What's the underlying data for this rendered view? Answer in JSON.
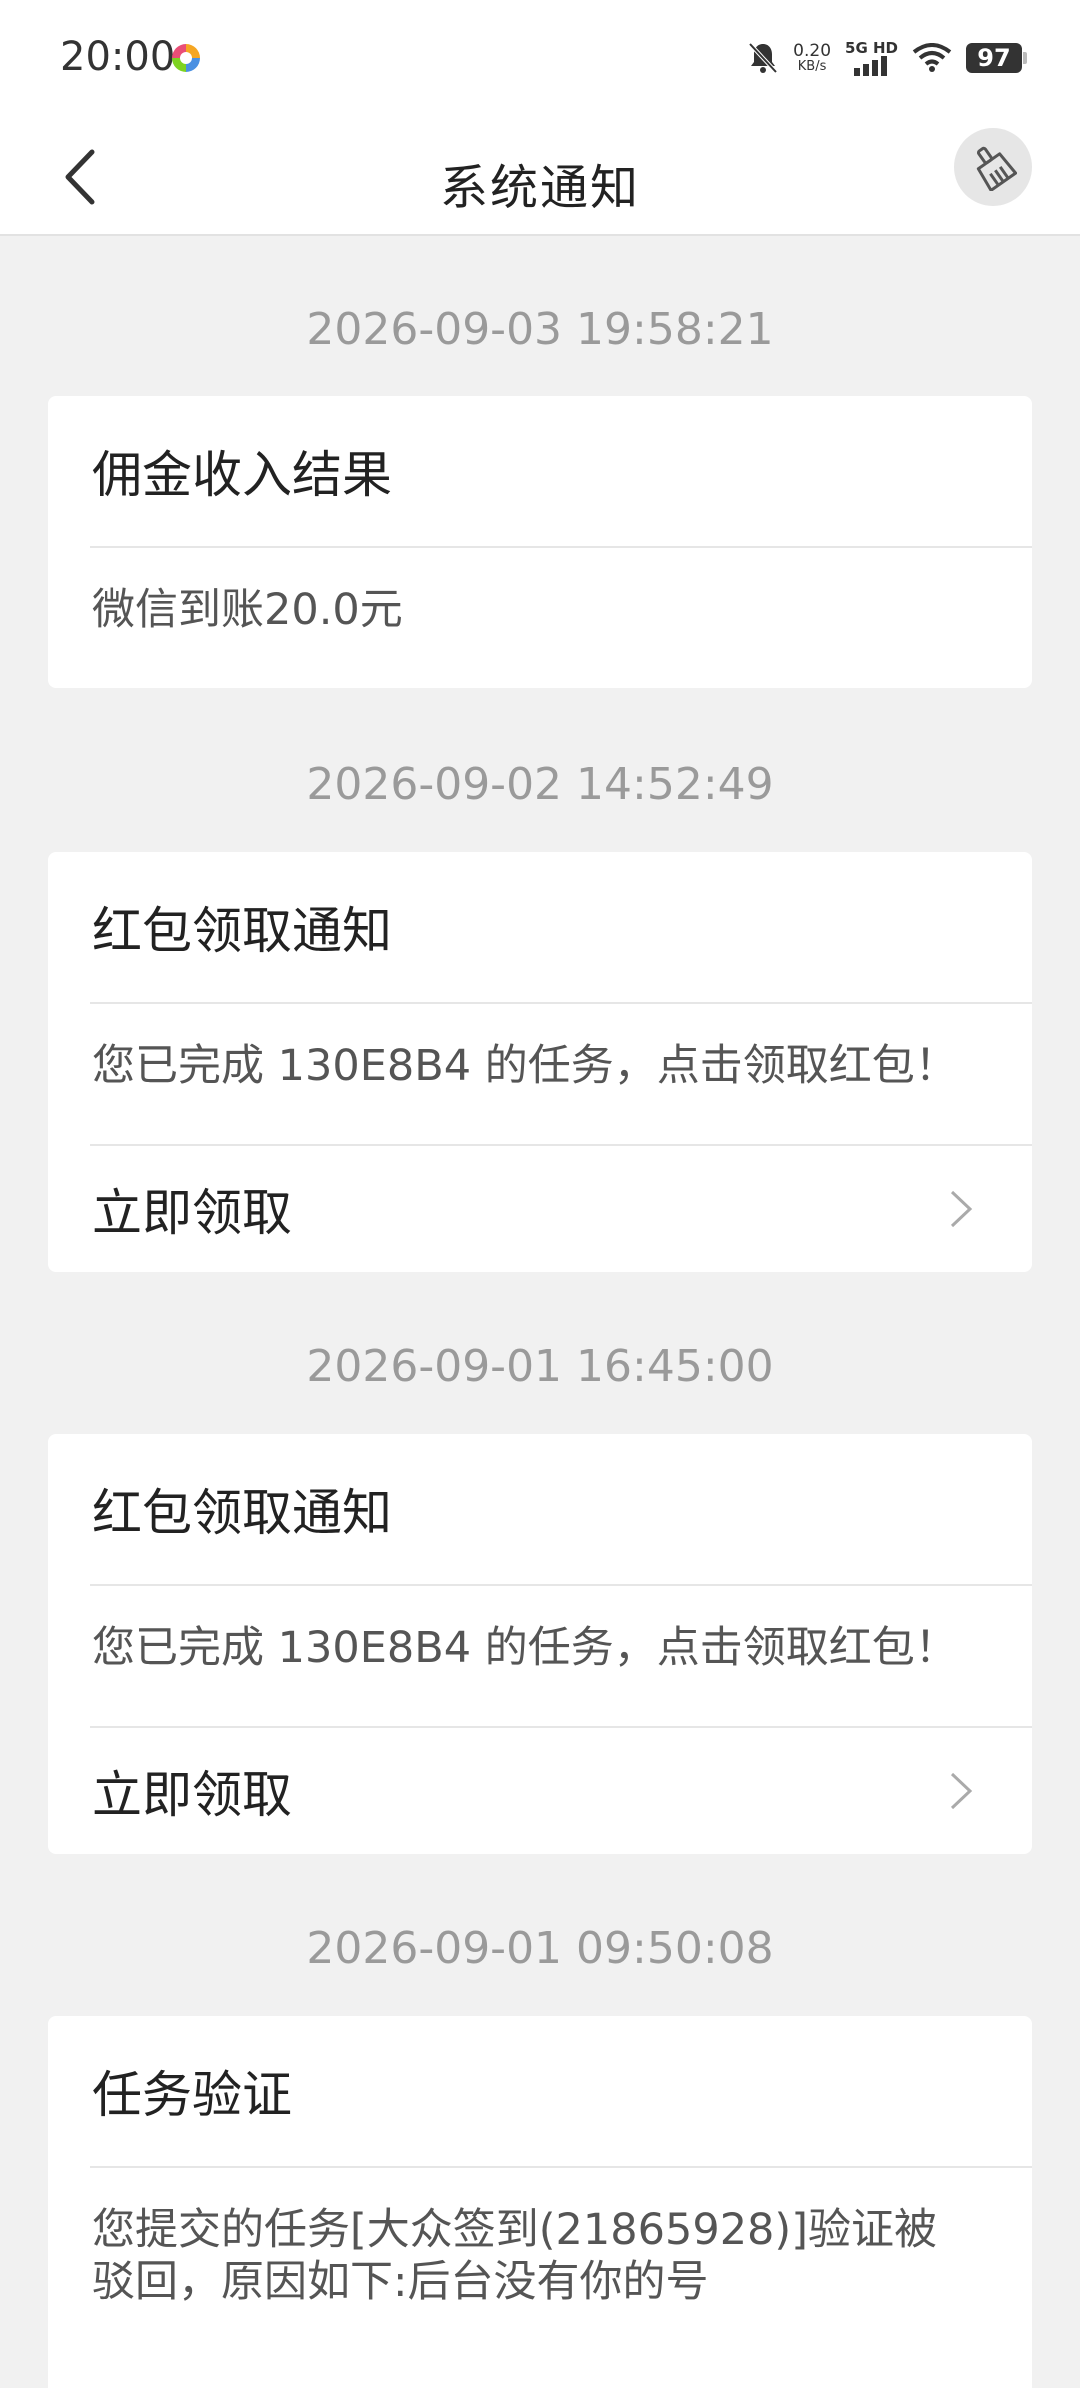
{
  "status_bar": {
    "time": "20:00",
    "net_speed": "0.20",
    "net_speed_unit": "KB/s",
    "network_label": "5G HD",
    "battery": "97",
    "icons": [
      "app-icon",
      "mute-icon",
      "signal-icon",
      "wifi-icon",
      "battery-icon"
    ]
  },
  "nav": {
    "title": "系统通知",
    "back_icon": "chevron-left-icon",
    "clear_icon": "broom-icon"
  },
  "notifications": [
    {
      "timestamp": "2026-09-03 19:58:21",
      "title": "佣金收入结果",
      "body": "微信到账20.0元"
    },
    {
      "timestamp": "2026-09-02 14:52:49",
      "title": "红包领取通知",
      "body": "您已完成 130E8B4 的任务，点击领取红包！",
      "action": "立即领取"
    },
    {
      "timestamp": "2026-09-01 16:45:00",
      "title": "红包领取通知",
      "body": "您已完成 130E8B4 的任务，点击领取红包！",
      "action": "立即领取"
    },
    {
      "timestamp": "2026-09-01 09:50:08",
      "title": "任务验证",
      "body": "您提交的任务[大众签到(21865928)]验证被驳回，原因如下:后台没有你的号"
    }
  ]
}
